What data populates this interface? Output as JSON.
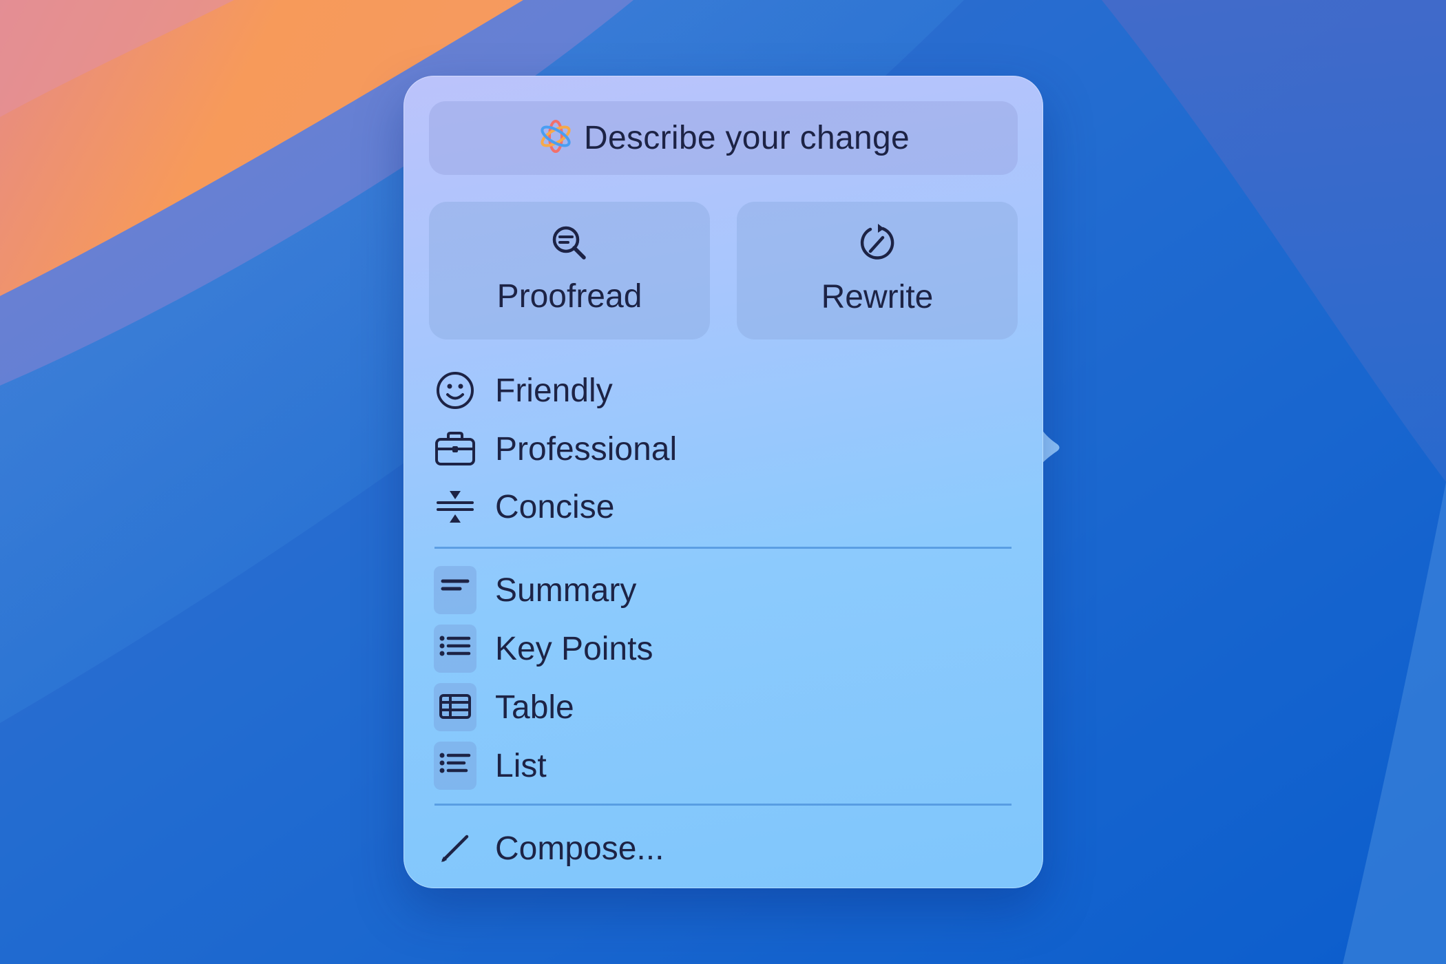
{
  "colors": {
    "text": "#1d2345",
    "panel_top": "#bcc3fb",
    "panel_bottom": "#7fc6fc",
    "divider": "#5a9ad8"
  },
  "prompt": {
    "icon": "apple-intelligence-icon",
    "label": "Describe your change"
  },
  "actions": [
    {
      "icon": "magnifier-text-icon",
      "label": "Proofread"
    },
    {
      "icon": "rewrite-circle-icon",
      "label": "Rewrite"
    }
  ],
  "tones": [
    {
      "icon": "smiley-icon",
      "label": "Friendly"
    },
    {
      "icon": "briefcase-icon",
      "label": "Professional"
    },
    {
      "icon": "concise-icon",
      "label": "Concise"
    }
  ],
  "formats": [
    {
      "icon": "summary-icon",
      "label": "Summary"
    },
    {
      "icon": "key-points-icon",
      "label": "Key Points"
    },
    {
      "icon": "table-icon",
      "label": "Table"
    },
    {
      "icon": "list-icon",
      "label": "List"
    }
  ],
  "compose": {
    "icon": "pencil-icon",
    "label": "Compose..."
  }
}
